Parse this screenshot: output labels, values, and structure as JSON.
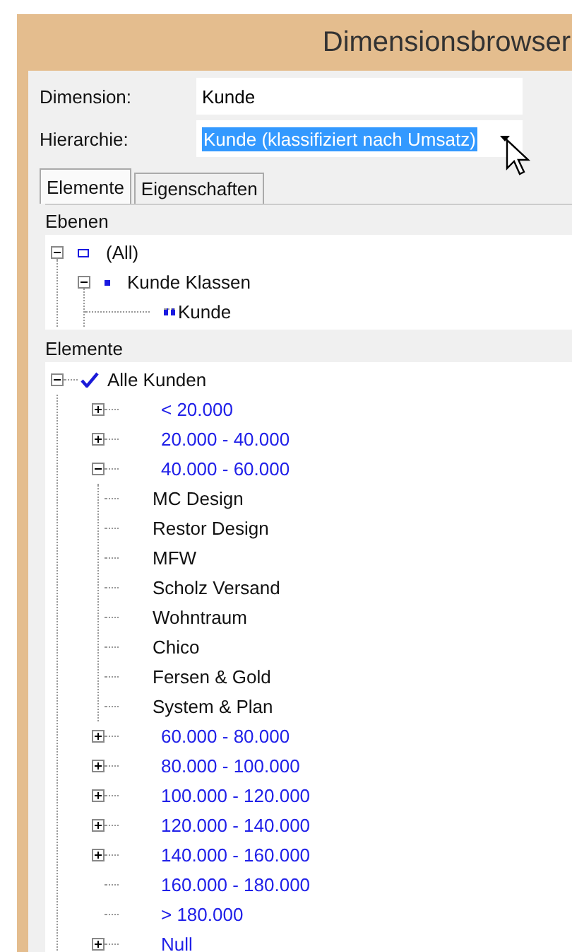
{
  "window": {
    "title": "Dimensionsbrowser"
  },
  "fields": [
    {
      "label": "Dimension:",
      "value": "Kunde",
      "kind": "text"
    },
    {
      "label": "Hierarchie:",
      "value": "Kunde (klassifiziert nach Umsatz)",
      "kind": "combo"
    }
  ],
  "tabs": [
    {
      "label": "Elemente",
      "selected": true
    },
    {
      "label": "Eigenschaften",
      "selected": false
    }
  ],
  "levels": {
    "title": "Ebenen",
    "items": [
      {
        "label": "(All)",
        "kind": "all",
        "expanded": true,
        "children": [
          {
            "label": "Kunde Klassen",
            "kind": "class",
            "expanded": true,
            "children": [
              {
                "label": "Kunde",
                "kind": "leaf"
              }
            ]
          }
        ]
      }
    ]
  },
  "elements": {
    "title": "Elemente",
    "items": [
      {
        "label": "Alle Kunden",
        "kind": "root",
        "expanded": true,
        "children": [
          {
            "label": "< 20.000",
            "kind": "range",
            "expanded": false
          },
          {
            "label": "20.000 - 40.000",
            "kind": "range",
            "expanded": false
          },
          {
            "label": "40.000 - 60.000",
            "kind": "range",
            "expanded": true,
            "children": [
              {
                "label": "MC Design",
                "kind": "customer"
              },
              {
                "label": "Restor Design",
                "kind": "customer"
              },
              {
                "label": "MFW",
                "kind": "customer"
              },
              {
                "label": "Scholz Versand",
                "kind": "customer"
              },
              {
                "label": "Wohntraum",
                "kind": "customer"
              },
              {
                "label": "Chico",
                "kind": "customer"
              },
              {
                "label": "Fersen & Gold",
                "kind": "customer"
              },
              {
                "label": "System & Plan",
                "kind": "customer"
              }
            ]
          },
          {
            "label": "60.000 - 80.000",
            "kind": "range",
            "expanded": false
          },
          {
            "label": "80.000 - 100.000",
            "kind": "range",
            "expanded": false
          },
          {
            "label": "100.000 - 120.000",
            "kind": "range",
            "expanded": false
          },
          {
            "label": "120.000 - 140.000",
            "kind": "range",
            "expanded": false
          },
          {
            "label": "140.000 - 160.000",
            "kind": "range",
            "expanded": false
          },
          {
            "label": "160.000 - 180.000",
            "kind": "range"
          },
          {
            "label": "> 180.000",
            "kind": "range"
          },
          {
            "label": "Null",
            "kind": "range",
            "expanded": false
          }
        ]
      }
    ]
  }
}
